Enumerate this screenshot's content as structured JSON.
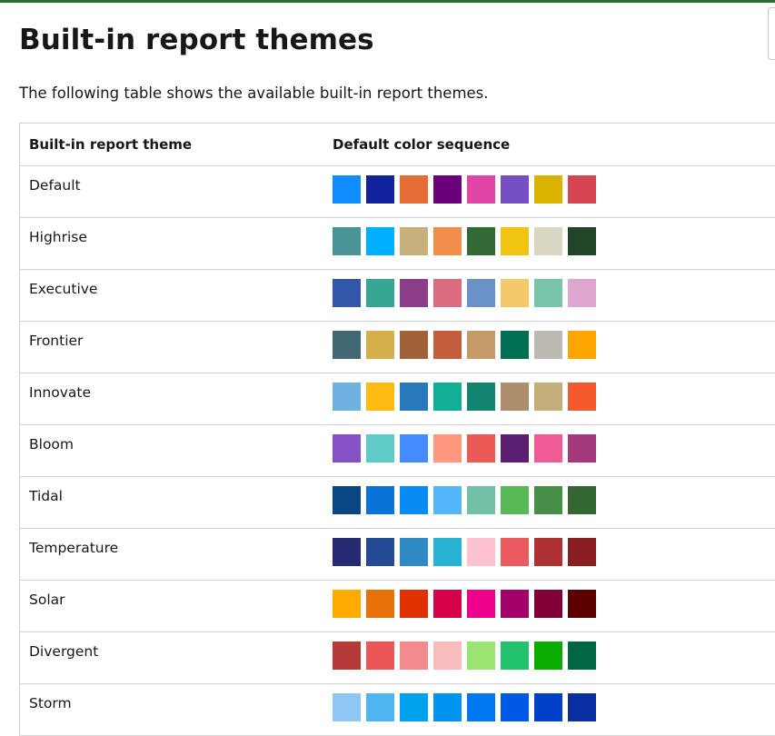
{
  "page": {
    "title": "Built-in report themes",
    "intro": "The following table shows the available built-in report themes."
  },
  "table": {
    "headers": {
      "theme": "Built-in report theme",
      "sequence": "Default color sequence"
    },
    "rows": [
      {
        "name": "Default",
        "colors": [
          "#118DFF",
          "#12239E",
          "#E66C37",
          "#6B007B",
          "#E044A7",
          "#744EC2",
          "#D9B300",
          "#D64550"
        ]
      },
      {
        "name": "Highrise",
        "colors": [
          "#4A9397",
          "#00B0FF",
          "#C6B07C",
          "#F28E4C",
          "#326935",
          "#F2C512",
          "#D9D7C1",
          "#22452A"
        ]
      },
      {
        "name": "Executive",
        "colors": [
          "#3257A8",
          "#37A794",
          "#8B3D88",
          "#DD6B7F",
          "#6B91C9",
          "#F5C869",
          "#77C4A8",
          "#DEA6CF"
        ]
      },
      {
        "name": "Frontier",
        "colors": [
          "#416872",
          "#D5B04A",
          "#A16139",
          "#C45C3E",
          "#C49A69",
          "#006E51",
          "#BDBAB3",
          "#FFA500"
        ]
      },
      {
        "name": "Innovate",
        "colors": [
          "#6FB1E0",
          "#FDBA12",
          "#2878BD",
          "#11B095",
          "#13846F",
          "#AD8E6D",
          "#C4AF7C",
          "#F45A2B"
        ]
      },
      {
        "name": "Bloom",
        "colors": [
          "#8651C5",
          "#5FCBC7",
          "#458DFF",
          "#FF987E",
          "#EB5A56",
          "#5A1F70",
          "#EF5C95",
          "#A33A7B"
        ]
      },
      {
        "name": "Tidal",
        "colors": [
          "#094782",
          "#0B72D7",
          "#098BF5",
          "#54B5FB",
          "#71C0A7",
          "#57B956",
          "#478F48",
          "#326633"
        ]
      },
      {
        "name": "Temperature",
        "colors": [
          "#252A73",
          "#244A94",
          "#2F8AC4",
          "#27B1D3",
          "#FFC2D0",
          "#EB5A5E",
          "#AD3033",
          "#8B1E20"
        ]
      },
      {
        "name": "Solar",
        "colors": [
          "#FFAB00",
          "#E8710A",
          "#E03100",
          "#D50048",
          "#EC008C",
          "#A4006A",
          "#800036",
          "#5C0000"
        ]
      },
      {
        "name": "Divergent",
        "colors": [
          "#B73A3A",
          "#EC5656",
          "#F28A90",
          "#F8BCBD",
          "#99E472",
          "#23C26F",
          "#0AAC00",
          "#026645"
        ]
      },
      {
        "name": "Storm",
        "colors": [
          "#8EC7F3",
          "#4FB5F2",
          "#00A2F0",
          "#0094F0",
          "#0078F0",
          "#0058E6",
          "#0040C8",
          "#0A2FA3"
        ]
      }
    ]
  }
}
